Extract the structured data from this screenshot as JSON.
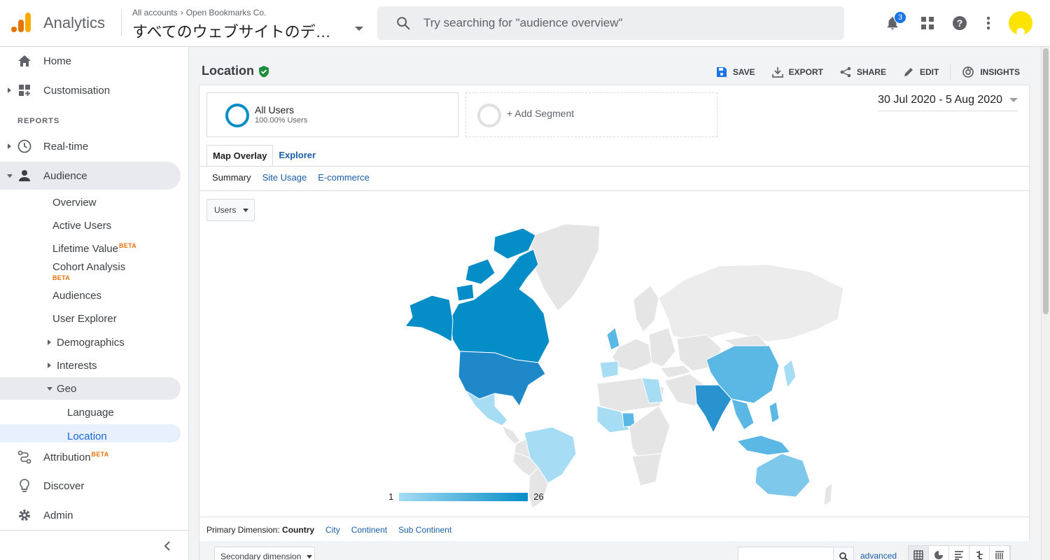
{
  "app": {
    "title": "Analytics"
  },
  "account": {
    "crumb_root": "All accounts",
    "crumb_property": "Open Bookmarks Co.",
    "view": "すべてのウェブサイトのデータ"
  },
  "search": {
    "placeholder": "Try searching for \"audience overview\""
  },
  "notifications": {
    "count": "3"
  },
  "sidebar": {
    "home": "Home",
    "customisation": "Customisation",
    "reports_header": "REPORTS",
    "realtime": "Real-time",
    "audience": "Audience",
    "audience_items": {
      "overview": "Overview",
      "active_users": "Active Users",
      "lifetime_value": "Lifetime Value",
      "cohort_analysis": "Cohort Analysis",
      "audiences": "Audiences",
      "user_explorer": "User Explorer",
      "demographics": "Demographics",
      "interests": "Interests",
      "geo": "Geo",
      "language": "Language",
      "location": "Location"
    },
    "beta": "BETA",
    "attribution": "Attribution",
    "discover": "Discover",
    "admin": "Admin"
  },
  "page": {
    "title": "Location",
    "actions": {
      "save": "SAVE",
      "export": "EXPORT",
      "share": "SHARE",
      "edit": "EDIT",
      "insights": "INSIGHTS"
    }
  },
  "segments": {
    "all_users": "All Users",
    "all_users_pct": "100.00% Users",
    "add": "+ Add Segment"
  },
  "date_range": "30 Jul 2020 - 5 Aug 2020",
  "tabs": {
    "map_overlay": "Map Overlay",
    "explorer": "Explorer"
  },
  "subtabs": {
    "summary": "Summary",
    "site_usage": "Site Usage",
    "ecommerce": "E-commerce"
  },
  "metric": "Users",
  "legend": {
    "min": "1",
    "max": "26",
    "color_low": "#a6dcf4",
    "color_high": "#058dc7"
  },
  "primary_dimension": {
    "label": "Primary Dimension:",
    "current": "Country",
    "city": "City",
    "continent": "Continent",
    "sub_continent": "Sub Continent"
  },
  "table_controls": {
    "secondary_dimension": "Secondary dimension",
    "advanced": "advanced"
  },
  "colors": {
    "accent": "#1a73e8",
    "map_high": "#058dc7",
    "map_low": "#a6dcf4"
  }
}
